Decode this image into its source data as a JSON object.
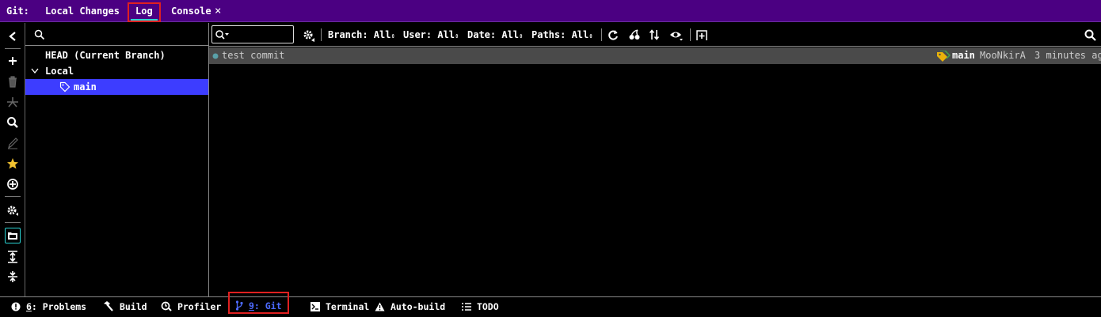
{
  "top_tabs": {
    "prefix": "Git:",
    "local_changes": "Local Changes",
    "log": "Log",
    "console": "Console",
    "close_glyph": "×"
  },
  "left_toolbar": {
    "icons": [
      "back-arrow-icon",
      "add-icon",
      "delete-icon",
      "merge-icon",
      "search-icon",
      "edit-icon",
      "star-icon",
      "target-icon",
      "settings-icon",
      "folder-icon",
      "expand-all-icon",
      "collapse-all-icon"
    ]
  },
  "branches": {
    "head": "HEAD (Current Branch)",
    "local_group": "Local",
    "items": [
      "main"
    ],
    "selected_color": "#3d3dff"
  },
  "log_toolbar": {
    "branch": "Branch: All",
    "user": "User: All",
    "date": "Date: All",
    "paths": "Paths: All",
    "dropdown_glyph": "⇕"
  },
  "commits": [
    {
      "message": "test commit",
      "ref": "main",
      "author": "MooNkirA",
      "date": "3 minutes ag"
    }
  ],
  "bottom_tabs": {
    "problems_num": "6",
    "problems": ": Problems",
    "build": "Build",
    "profiler": "Profiler",
    "git_num": "9",
    "git": ": Git",
    "terminal": "Terminal",
    "autobuild": "Auto-build",
    "todo": "TODO"
  },
  "colors": {
    "tab_bar_bg": "#4b0082",
    "active_underline": "#2ad3d3",
    "highlight_box": "#e02020",
    "git_active_text": "#4d6bff",
    "commit_row_bg": "#4a4a4a",
    "star": "#f2c230",
    "tag_icon": "#e8b20a"
  }
}
